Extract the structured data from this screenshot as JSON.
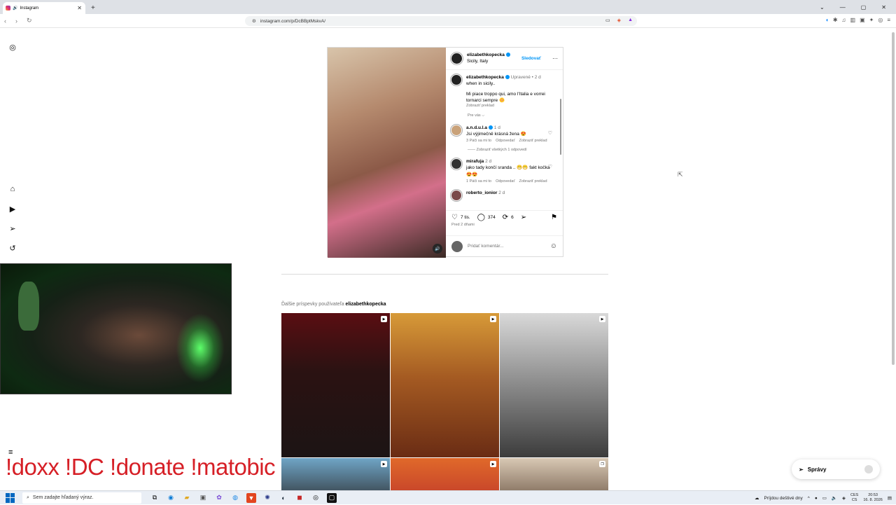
{
  "browser": {
    "tab_title": "Instagram",
    "new_tab": "+",
    "url": "instagram.com/p/DcBBptMskvA/"
  },
  "post": {
    "username": "elizabethkopecka",
    "location": "Sicily, Italy",
    "follow_label": "Sledovať",
    "caption_edited": "Upravené • 2 d",
    "caption_line1": "when in sicily..",
    "caption_line2": "Mi piace troppo qui, amo l'Italia e vorrei tornarci sempre 🌼",
    "translate_label": "Zobraziť preklad",
    "for_you": "Pre vás ⌵",
    "comments": [
      {
        "user": "a.n.d.u.l.a",
        "age": "1 d",
        "text": "Jsi výjimečně krásná žena 😍",
        "likes": "3 Páči sa mi to",
        "reply": "Odpovedať",
        "translate": "Zobraziť preklad"
      },
      {
        "user": "mirafuja",
        "age": "2 d",
        "text": "jako tady končí sranda .. 😁😁 fakt kočka 😍😍",
        "likes": "1 Páči sa mi to",
        "reply": "Odpovedať",
        "translate": "Zobraziť preklad"
      },
      {
        "user": "roberto_ionior",
        "age": "2 d"
      }
    ],
    "view_replies": "Zobraziť všetkých 1 odpovedí",
    "likes_count": "7 tis.",
    "comments_count": "374",
    "reposts_count": "6",
    "posted_ago": "Pred 2 dňami",
    "add_comment_placeholder": "Pridať komentár..."
  },
  "more_posts": {
    "prefix": "Ďalšie príspevky používateľa",
    "username": "elizabethkopecka"
  },
  "overlay": {
    "text": "!doxx  !DC !donate !matobic"
  },
  "messages": {
    "label": "Správy"
  },
  "taskbar": {
    "search_placeholder": "Sem zadajte hľadaný výraz.",
    "weather": "Príjdou deštivé dny",
    "lang_top": "CES",
    "lang_bottom": "CS",
    "time": "20:53",
    "date": "16. 8. 2026"
  }
}
